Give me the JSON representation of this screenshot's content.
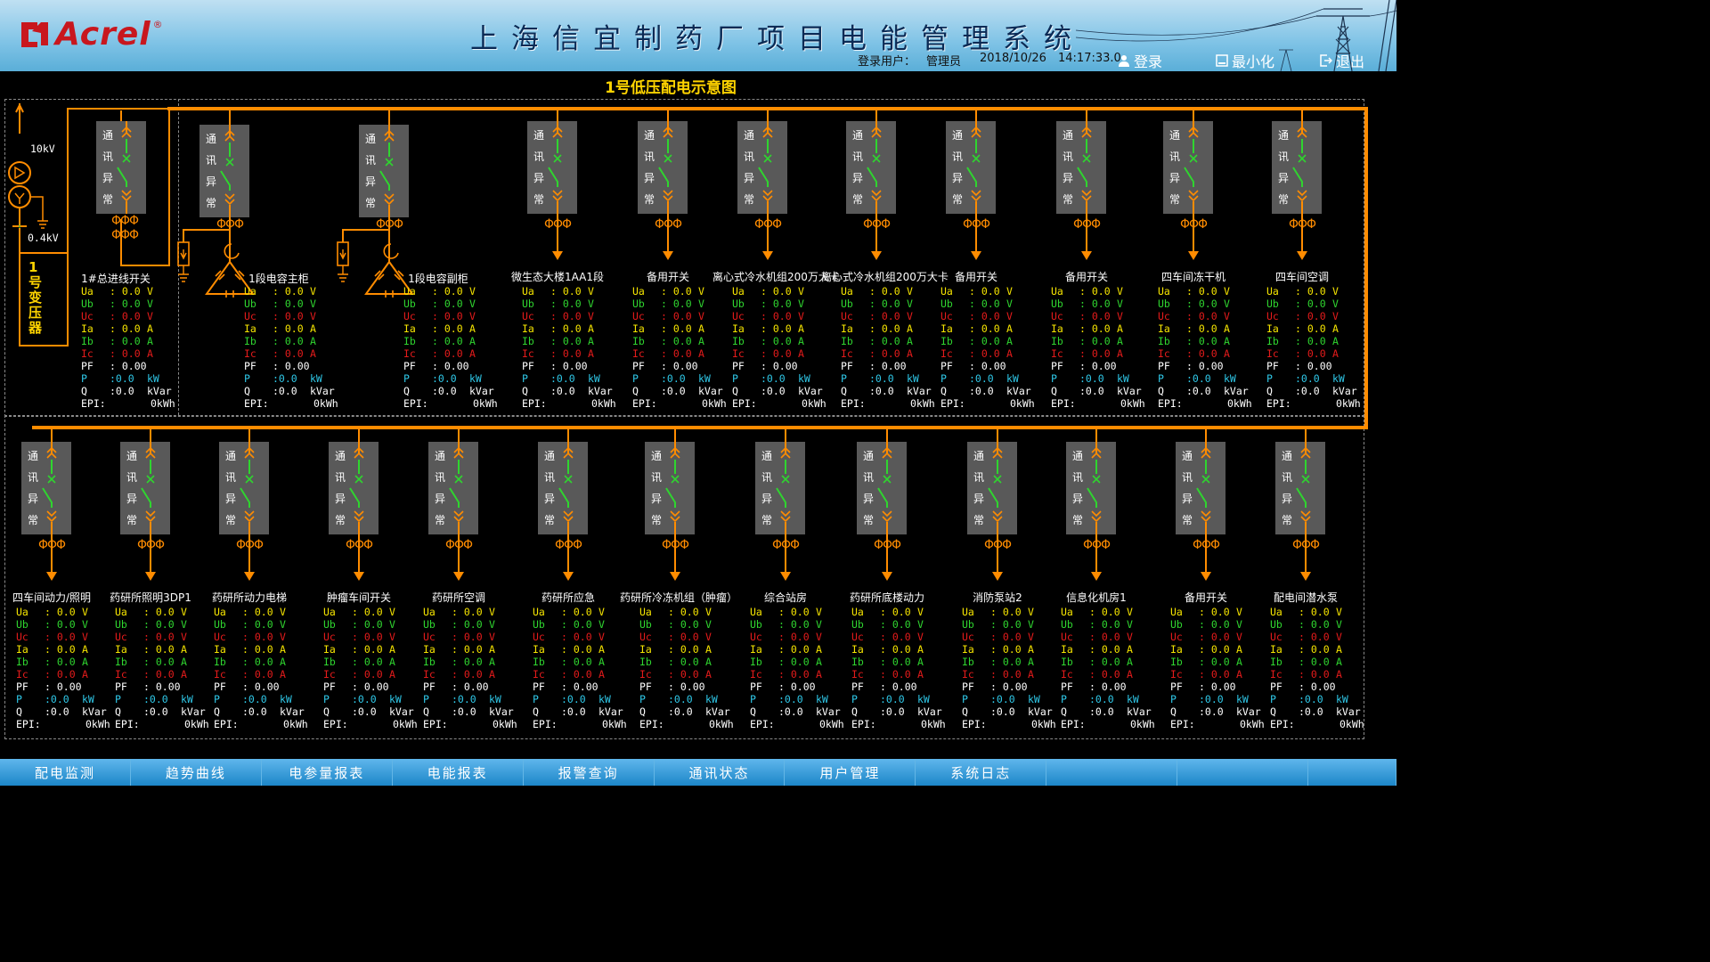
{
  "header": {
    "logo": "Acrel",
    "logo_mark": "®",
    "title": "上海信宜制药厂项目电能管理系统",
    "login_label": "登录用户：",
    "user": "管理员",
    "date": "2018/10/26",
    "time": "14:17:33.0",
    "login_button": "登录",
    "minimize_button": "最小化",
    "exit_button": "退出"
  },
  "diagram": {
    "title": "1号低压配电示意图",
    "voltage_hv": "10kV",
    "voltage_lv": "0.4kV",
    "transformer_label": "1号变压器",
    "status_chars": [
      "通",
      "讯",
      "异",
      "常"
    ],
    "phase_symbols": "ΦΦΦ",
    "capacitor_feeders": [
      {
        "title": "1段电容主柜"
      },
      {
        "title": "1段电容副柜"
      }
    ],
    "feeders_top": [
      {
        "title": "1#总进线开关"
      },
      {
        "title": "微生态大楼1AA1段"
      },
      {
        "title": "备用开关"
      },
      {
        "title": "离心式冷水机组200万大卡"
      },
      {
        "title": "离心式冷水机组200万大卡"
      },
      {
        "title": "备用开关"
      },
      {
        "title": "备用开关"
      },
      {
        "title": "四车间冻干机"
      },
      {
        "title": "四车间空调"
      }
    ],
    "feeders_bottom": [
      {
        "title": "四车间动力/照明"
      },
      {
        "title": "药研所照明3DP1"
      },
      {
        "title": "药研所动力电梯"
      },
      {
        "title": "肿瘤车间开关"
      },
      {
        "title": "药研所空调"
      },
      {
        "title": "药研所应急"
      },
      {
        "title": "药研所冷冻机组（肿瘤）"
      },
      {
        "title": "综合站房"
      },
      {
        "title": "药研所底楼动力"
      },
      {
        "title": "消防泵站2"
      },
      {
        "title": "信息化机房1"
      },
      {
        "title": "备用开关"
      },
      {
        "title": "配电间潜水泵"
      }
    ],
    "measurements": [
      {
        "key": "Ua",
        "value": ": 0.0",
        "unit": "V",
        "color": "#f5e400"
      },
      {
        "key": "Ub",
        "value": ": 0.0",
        "unit": "V",
        "color": "#2fd52f"
      },
      {
        "key": "Uc",
        "value": ": 0.0",
        "unit": "V",
        "color": "#e41b1b"
      },
      {
        "key": "Ia",
        "value": ": 0.0",
        "unit": "A",
        "color": "#f5e400"
      },
      {
        "key": "Ib",
        "value": ": 0.0",
        "unit": "A",
        "color": "#2fd52f"
      },
      {
        "key": "Ic",
        "value": ": 0.0",
        "unit": "A",
        "color": "#e41b1b"
      },
      {
        "key": "PF",
        "value": ": 0.00",
        "unit": "",
        "color": "#ffffff"
      },
      {
        "key": "P",
        "value": ":0.0",
        "unit": "kW",
        "color": "#2fc8e8"
      },
      {
        "key": "Q",
        "value": ":0.0",
        "unit": "kVar",
        "color": "#ffffff"
      },
      {
        "key": "EPI:",
        "value": "",
        "unit": "0kWh",
        "color": "#ffffff"
      }
    ]
  },
  "footer": {
    "tabs": [
      "配电监测",
      "趋势曲线",
      "电参量报表",
      "电能报表",
      "报警查询",
      "通讯状态",
      "用户管理",
      "系统日志",
      "",
      "",
      ""
    ]
  },
  "colors": {
    "busbar": "#ff8c00",
    "breaker_closed": "#2fd52f",
    "title": "#ffd400",
    "switch_box": "#595959",
    "header_bg": "#7fc3e6",
    "footer_bg": "#1d8fd0"
  }
}
